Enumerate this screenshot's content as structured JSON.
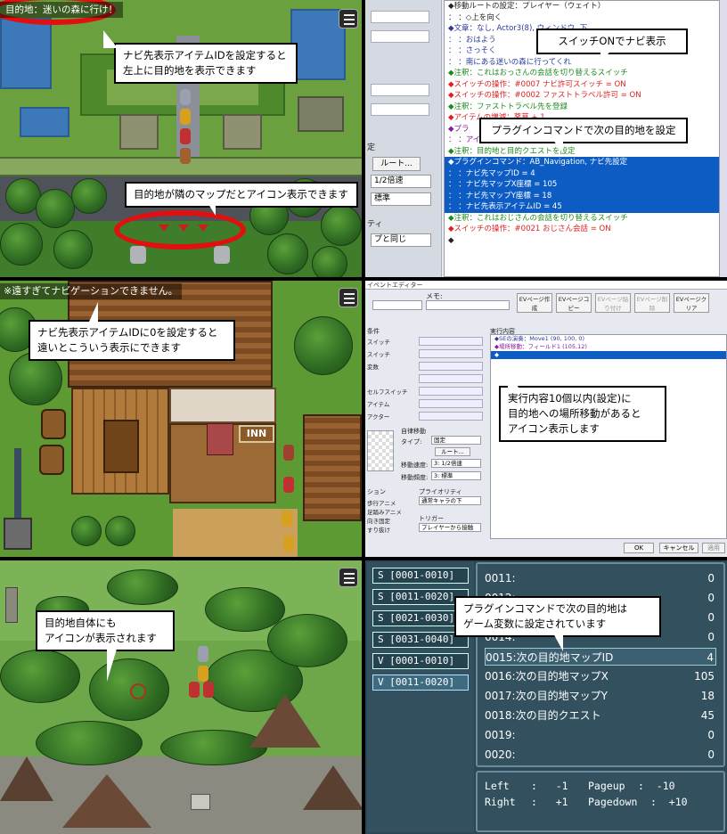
{
  "panel1": {
    "banner_text": "目的地：迷いの森に行け！",
    "callout1_line1": "ナビ先表示アイテムIDを設定すると",
    "callout1_line2": "左上に目的地を表示できます",
    "callout2": "目的地が隣のマップだとアイコン表示できます"
  },
  "panel2": {
    "callout1": "スイッチONでナビ表示",
    "callout2": "プラグインコマンドで次の目的地を設定",
    "left_labels": [
      "定",
      "ルート...",
      "1/2倍速",
      "標準",
      "ティ",
      "プと同じ"
    ],
    "lines": [
      {
        "text": "◆移動ルートの設定：プレイヤー（ウェイト）",
        "cls": "dark"
      },
      {
        "text": "：                ：◇上を向く",
        "cls": "dark"
      },
      {
        "text": "◆文章：なし, Actor3(8), ウィンドウ, 下",
        "cls": "blue"
      },
      {
        "text": "：    ：おはよう",
        "cls": "blue"
      },
      {
        "text": "：    ：さっそく",
        "cls": "blue"
      },
      {
        "text": "：    ：南にある迷いの森に行ってくれ",
        "cls": "blue"
      },
      {
        "text": "◆注釈：これはおっさんの会話を切り替えるスイッチ",
        "cls": "green"
      },
      {
        "text": "◆スイッチの操作：#0007 ナビ許可スイッチ = ON",
        "cls": "red"
      },
      {
        "text": "◆スイッチの操作：#0002 ファストトラベル許可 = ON",
        "cls": "red"
      },
      {
        "text": "◆注釈：ファストトラベル先を登録",
        "cls": "green"
      },
      {
        "text": "◆アイテムの増減：薬草 + 1",
        "cls": "red"
      },
      {
        "text": "◆プラ",
        "cls": "purple"
      },
      {
        "text": "：                ：アイテムID = 4",
        "cls": "purple"
      },
      {
        "text": "◆注釈：目的地と目的クエストを設定",
        "cls": "green"
      },
      {
        "text": "◆プラグインコマンド：AB_Navigation, ナビ先設定",
        "cls": "sel"
      },
      {
        "text": "：                ：ナビ先マップID = 4",
        "cls": "sel"
      },
      {
        "text": "：                ：ナビ先マップX座標 = 105",
        "cls": "sel"
      },
      {
        "text": "：                ：ナビ先マップY座標 = 18",
        "cls": "sel"
      },
      {
        "text": "：                ：ナビ先表示アイテムID = 45",
        "cls": "sel"
      },
      {
        "text": "◆注釈：これはおじさんの会話を切り替えるスイッチ",
        "cls": "green"
      },
      {
        "text": "◆スイッチの操作：#0021 おじさん会話 = ON",
        "cls": "red"
      },
      {
        "text": "◆",
        "cls": "dark"
      }
    ]
  },
  "panel3": {
    "warning": "※遠すぎてナビゲーションできません。",
    "callout_line1": "ナビ先表示アイテムIDに0を設定すると",
    "callout_line2": "遠いとこういう表示にできます",
    "inn_sign": "INN"
  },
  "panel4": {
    "window_title": "イベントエディター",
    "memo_label": "メモ:",
    "buttons": [
      "EVページ作成",
      "EVページコピー",
      "EVページ貼り付け",
      "EVページ削除",
      "EVページクリア"
    ],
    "conditions_label": "条件",
    "cond_labels": [
      "スイッチ",
      "スイッチ",
      "変数",
      "",
      "セルフスイッチ",
      "アイテム",
      "アクター"
    ],
    "exec_label": "実行内容",
    "exec_lines": [
      "◆SEの演奏：Move1 (90, 100, 0)",
      "◆場所移動：フィールド1 (105,12)",
      "◆"
    ],
    "autonomous_label": "自律移動",
    "type_label": "タイプ:",
    "type_value": "固定",
    "route_btn": "ルート...",
    "speed_label": "移動速度:",
    "speed_value": "3: 1/2倍速",
    "freq_label": "移動頻度:",
    "freq_value": "3: 標準",
    "options_label": "ション",
    "opt_items": [
      "歩行アニメ",
      "足踏みアニメ",
      "向き固定",
      "すり抜け"
    ],
    "priority_label": "プライオリティ",
    "priority_value": "通常キャラの下",
    "trigger_label": "トリガー",
    "trigger_value": "プレイヤーから接触",
    "ok": "OK",
    "cancel": "キャンセル",
    "apply": "適用",
    "callout_line1": "実行内容10個以内(設定)に",
    "callout_line2": "目的地への場所移動があると",
    "callout_line3": "アイコン表示します"
  },
  "panel5": {
    "callout_line1": "目的地自体にも",
    "callout_line2": "アイコンが表示されます"
  },
  "panel6": {
    "ranges": [
      {
        "label": "S [0001-0010]",
        "active": false
      },
      {
        "label": "S [0011-0020]",
        "active": false
      },
      {
        "label": "S [0021-0030]",
        "active": false
      },
      {
        "label": "S [0031-0040]",
        "active": false
      },
      {
        "label": "V [0001-0010]",
        "active": false
      },
      {
        "label": "V [0011-0020]",
        "active": true
      }
    ],
    "variables": [
      {
        "key": "0011:",
        "value": "0"
      },
      {
        "key": "0012:",
        "value": "0"
      },
      {
        "key": "0013:",
        "value": "0"
      },
      {
        "key": "0014:",
        "value": "0"
      },
      {
        "key": "0015:次の目的地マップID",
        "value": "4"
      },
      {
        "key": "0016:次の目的地マップX",
        "value": "105"
      },
      {
        "key": "0017:次の目的地マップY",
        "value": "18"
      },
      {
        "key": "0018:次の目的クエスト",
        "value": "45"
      },
      {
        "key": "0019:",
        "value": "0"
      },
      {
        "key": "0020:",
        "value": "0"
      }
    ],
    "help": {
      "left_key": "Left",
      "left_val": ":   -1",
      "right_key": "Right",
      "right_val": ":   +1",
      "pageup_key": "Pageup",
      "pageup_val": ":  -10",
      "pagedown_key": "Pagedown",
      "pagedown_val": ":  +10"
    },
    "callout_line1": "プラグインコマンドで次の目的地は",
    "callout_line2": "ゲーム変数に設定されています"
  }
}
